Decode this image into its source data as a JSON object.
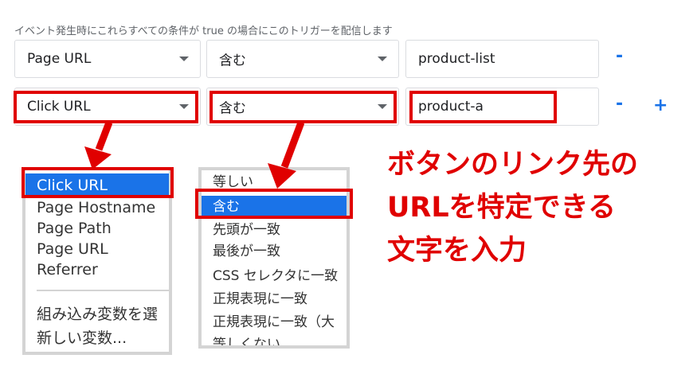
{
  "condition_description": "イベント発生時にこれらすべての条件が true の場合にこのトリガーを配信します",
  "rows": [
    {
      "variable": "Page URL",
      "operator": "含む",
      "value": "product-list",
      "remove": "-"
    },
    {
      "variable": "Click URL",
      "operator": "含む",
      "value": "product-a",
      "remove": "-",
      "add": "+"
    }
  ],
  "variable_dropdown": {
    "options": [
      "Click URL",
      "Page Hostname",
      "Page Path",
      "Page URL",
      "Referrer"
    ],
    "selected": "Click URL",
    "extra_options": [
      "組み込み変数を選",
      "新しい変数..."
    ]
  },
  "operator_dropdown": {
    "options": [
      "等しい",
      "含む",
      "先頭が一致",
      "最後が一致",
      "CSS セレクタに一致",
      "正規表現に一致",
      "正規表現に一致（大",
      "等しくない"
    ],
    "selected": "含む"
  },
  "annotation": [
    "ボタンのリンク先の",
    "URLを特定できる",
    "文字を入力"
  ],
  "colors": {
    "highlight": "#e00000",
    "selected": "#1a73e8",
    "accent": "#1a73e8"
  }
}
